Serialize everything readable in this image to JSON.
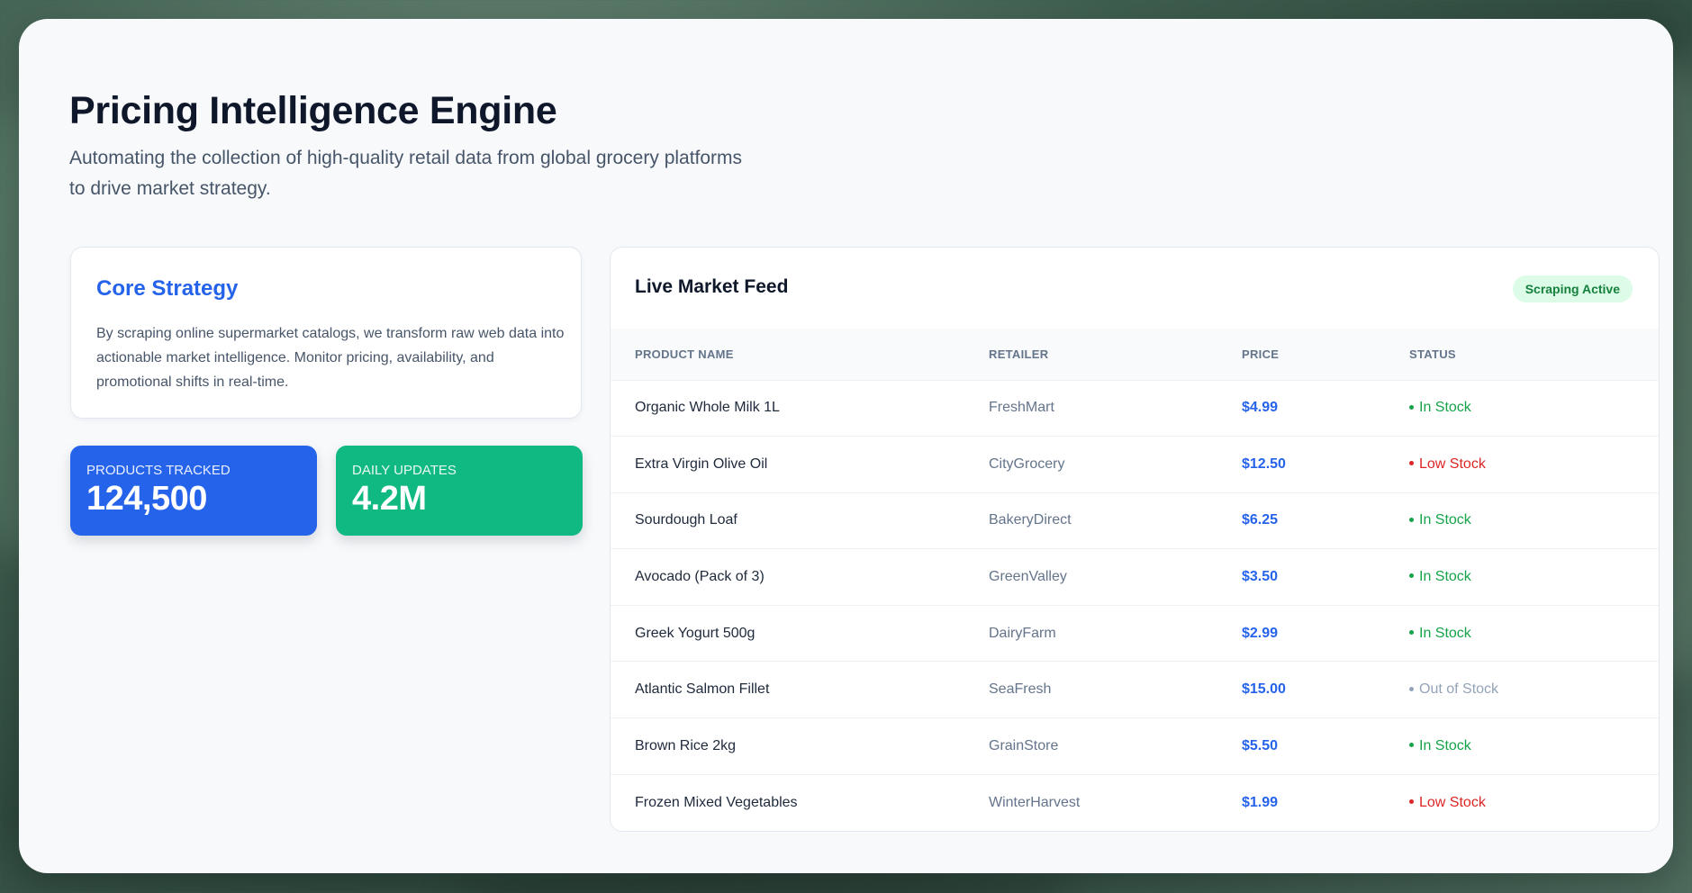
{
  "header": {
    "title": "Pricing Intelligence Engine",
    "subtitle": "Automating the collection of high-quality retail data from global grocery platforms to drive market strategy."
  },
  "strategy": {
    "heading": "Core Strategy",
    "body": "By scraping online supermarket catalogs, we transform raw web data into actionable market intelligence. Monitor pricing, availability, and promotional shifts in real-time."
  },
  "stats": [
    {
      "label": "Products Tracked",
      "value": "124,500",
      "color": "#2563eb"
    },
    {
      "label": "Daily Updates",
      "value": "4.2M",
      "color": "#10b981"
    }
  ],
  "feed": {
    "title": "Live Market Feed",
    "badge": "Scraping Active",
    "columns": [
      "Product Name",
      "Retailer",
      "Price",
      "Status"
    ],
    "rows": [
      {
        "product": "Organic Whole Milk 1L",
        "retailer": "FreshMart",
        "price": "$4.99",
        "status": "In Stock",
        "status_type": "in"
      },
      {
        "product": "Extra Virgin Olive Oil",
        "retailer": "CityGrocery",
        "price": "$12.50",
        "status": "Low Stock",
        "status_type": "low"
      },
      {
        "product": "Sourdough Loaf",
        "retailer": "BakeryDirect",
        "price": "$6.25",
        "status": "In Stock",
        "status_type": "in"
      },
      {
        "product": "Avocado (Pack of 3)",
        "retailer": "GreenValley",
        "price": "$3.50",
        "status": "In Stock",
        "status_type": "in"
      },
      {
        "product": "Greek Yogurt 500g",
        "retailer": "DairyFarm",
        "price": "$2.99",
        "status": "In Stock",
        "status_type": "in"
      },
      {
        "product": "Atlantic Salmon Fillet",
        "retailer": "SeaFresh",
        "price": "$15.00",
        "status": "Out of Stock",
        "status_type": "out"
      },
      {
        "product": "Brown Rice 2kg",
        "retailer": "GrainStore",
        "price": "$5.50",
        "status": "In Stock",
        "status_type": "in"
      },
      {
        "product": "Frozen Mixed Vegetables",
        "retailer": "WinterHarvest",
        "price": "$1.99",
        "status": "Low Stock",
        "status_type": "low"
      }
    ]
  },
  "colors": {
    "accent_blue": "#2563eb",
    "accent_green": "#10b981",
    "status_in": "#16a34a",
    "status_low": "#dc2626",
    "status_out": "#94a3b8"
  }
}
